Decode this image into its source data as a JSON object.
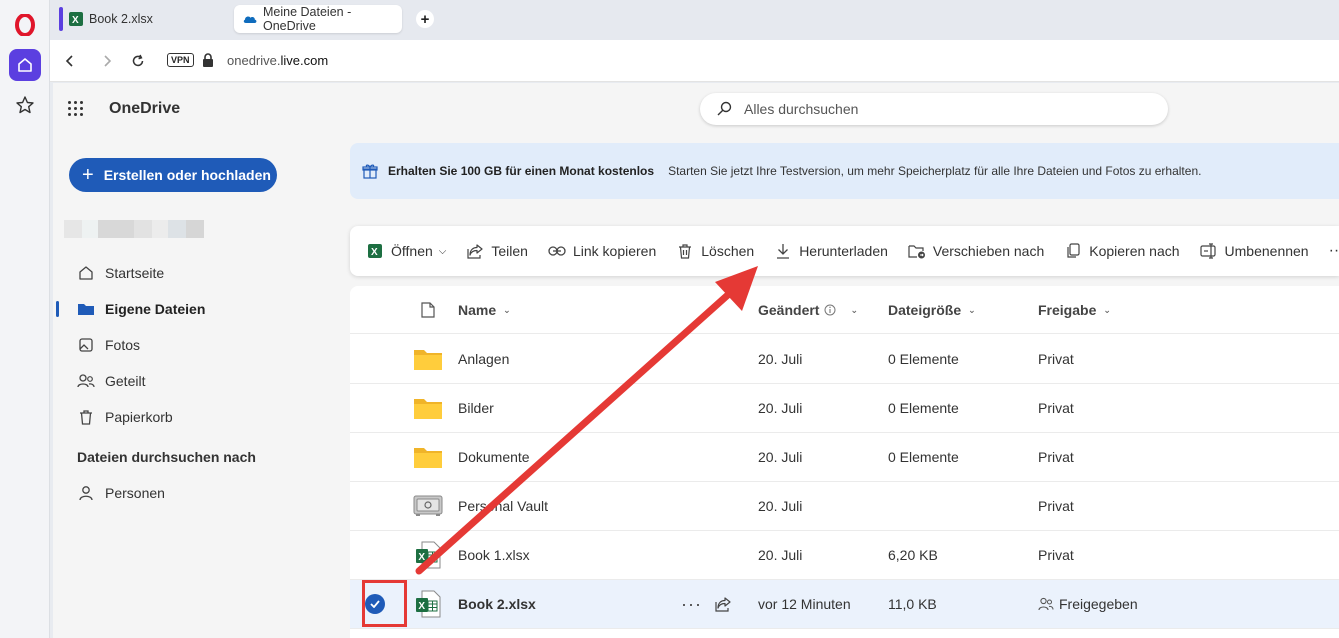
{
  "browser": {
    "tabs": [
      {
        "label": "Book 2.xlsx"
      },
      {
        "label": "Meine Dateien - OneDrive"
      }
    ],
    "new_tab_label": "+",
    "vpn_label": "VPN",
    "url_domain": "onedrive.",
    "url_rest": "live.com"
  },
  "app": {
    "brand": "OneDrive",
    "search_placeholder": "Alles durchsuchen"
  },
  "sidebar": {
    "create_button": "Erstellen oder hochladen",
    "items": [
      {
        "label": "Startseite",
        "icon": "home-icon"
      },
      {
        "label": "Eigene Dateien",
        "icon": "folder-icon",
        "active": true
      },
      {
        "label": "Fotos",
        "icon": "image-icon"
      },
      {
        "label": "Geteilt",
        "icon": "people-icon"
      },
      {
        "label": "Papierkorb",
        "icon": "trash-icon"
      }
    ],
    "section_title": "Dateien durchsuchen nach",
    "section_items": [
      {
        "label": "Personen",
        "icon": "person-icon"
      }
    ]
  },
  "banner": {
    "title": "Erhalten Sie 100 GB für einen Monat kostenlos",
    "text": "Starten Sie jetzt Ihre Testversion, um mehr Speicherplatz für alle Ihre Dateien und Fotos zu erhalten."
  },
  "commands": [
    {
      "label": "Öffnen",
      "icon": "excel-icon"
    },
    {
      "label": "Teilen",
      "icon": "share-icon"
    },
    {
      "label": "Link kopieren",
      "icon": "link-icon"
    },
    {
      "label": "Löschen",
      "icon": "trash-icon"
    },
    {
      "label": "Herunterladen",
      "icon": "download-icon"
    },
    {
      "label": "Verschieben nach",
      "icon": "move-icon"
    },
    {
      "label": "Kopieren nach",
      "icon": "copy-icon"
    },
    {
      "label": "Umbenennen",
      "icon": "rename-icon"
    }
  ],
  "more_label": "···",
  "columns": {
    "name": "Name",
    "modified": "Geändert",
    "size": "Dateigröße",
    "sharing": "Freigabe"
  },
  "files": [
    {
      "name": "Anlagen",
      "type": "folder",
      "modified": "20. Juli",
      "size": "0 Elemente",
      "sharing": "Privat"
    },
    {
      "name": "Bilder",
      "type": "folder",
      "modified": "20. Juli",
      "size": "0 Elemente",
      "sharing": "Privat"
    },
    {
      "name": "Dokumente",
      "type": "folder",
      "modified": "20. Juli",
      "size": "0 Elemente",
      "sharing": "Privat"
    },
    {
      "name": "Personal Vault",
      "type": "vault",
      "modified": "20. Juli",
      "size": "",
      "sharing": "Privat"
    },
    {
      "name": "Book 1.xlsx",
      "type": "excel",
      "modified": "20. Juli",
      "size": "6,20 KB",
      "sharing": "Privat"
    },
    {
      "name": "Book 2.xlsx",
      "type": "excel",
      "modified": "vor 12 Minuten",
      "size": "11,0 KB",
      "sharing": "Freigegeben",
      "selected": true
    }
  ],
  "colors": {
    "accent": "#1f5bb8",
    "opera": "#5b3fe0",
    "annotation": "#e53935"
  }
}
